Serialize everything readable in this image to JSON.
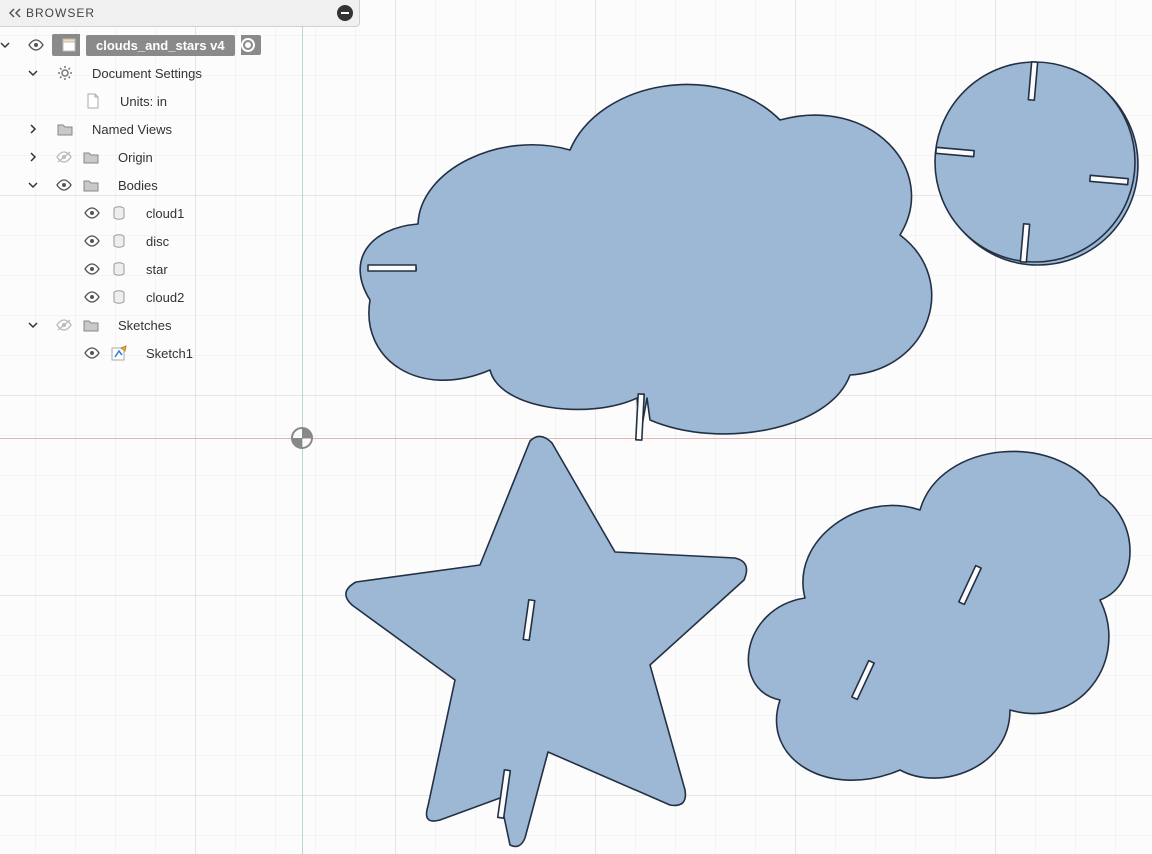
{
  "panel": {
    "title": "BROWSER"
  },
  "root": {
    "label": "clouds_and_stars v4",
    "active": true
  },
  "docSettings": {
    "label": "Document Settings",
    "units": "Units: in"
  },
  "namedViews": {
    "label": "Named Views"
  },
  "origin": {
    "label": "Origin"
  },
  "bodies": {
    "label": "Bodies",
    "items": [
      {
        "label": "cloud1"
      },
      {
        "label": "disc"
      },
      {
        "label": "star"
      },
      {
        "label": "cloud2"
      }
    ]
  },
  "sketches": {
    "label": "Sketches",
    "items": [
      {
        "label": "Sketch1"
      }
    ]
  },
  "shapeFill": "#9db8d5",
  "shapeStroke": "#233044"
}
